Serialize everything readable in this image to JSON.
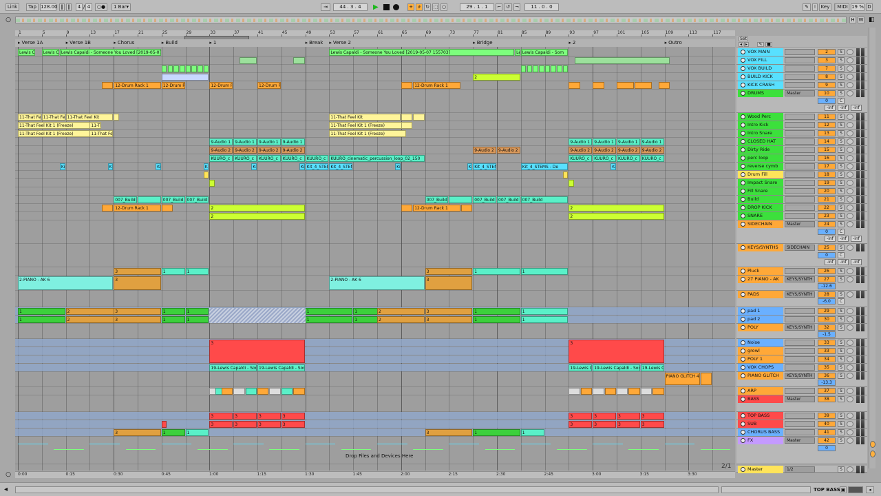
{
  "transport": {
    "link": "Link",
    "tap": "Tap",
    "tempo": "128.00",
    "signature_num": "4",
    "signature_den": "4",
    "metronome": "○●",
    "quantize": "1 Bar",
    "position": "44 .  3 .  4",
    "loop_start": "29 .  1 .  1",
    "loop_length": "11 .  0 .  0",
    "key": "Key",
    "midi": "MIDI",
    "cpu": "19 %",
    "disk": "D"
  },
  "overview_buttons": {
    "h": "H",
    "w": "W"
  },
  "ruler": {
    "bars": [
      "1",
      "5",
      "9",
      "13",
      "17",
      "21",
      "25",
      "29",
      "33",
      "37",
      "41",
      "45",
      "49",
      "53",
      "57",
      "61",
      "65",
      "69",
      "73",
      "77",
      "81",
      "85",
      "89",
      "93",
      "97",
      "101",
      "105",
      "109",
      "113",
      "117"
    ]
  },
  "locators": [
    {
      "label": "Verse 1A",
      "bar": 1
    },
    {
      "label": "Verse 1B",
      "bar": 9
    },
    {
      "label": "Chorus",
      "bar": 17
    },
    {
      "label": "Build",
      "bar": 25
    },
    {
      "label": "1",
      "bar": 33
    },
    {
      "label": "Break",
      "bar": 49
    },
    {
      "label": "Verse 2",
      "bar": 53
    },
    {
      "label": "Bridge",
      "bar": 77
    },
    {
      "label": "2",
      "bar": 93
    },
    {
      "label": "Outro",
      "bar": 109
    }
  ],
  "time_ruler": [
    "0:00",
    "0:15",
    "0:30",
    "0:45",
    "1:00",
    "1:15",
    "1:30",
    "1:45",
    "2:00",
    "2:15",
    "2:30",
    "2:45",
    "3:00",
    "3:15",
    "3:30"
  ],
  "drop_hint": "Drop Files and Devices Here",
  "page_indicator": "2/1",
  "set_label": "Set",
  "tracks": [
    {
      "name": "VOX MAIN",
      "color": "#58e0ff",
      "num": "2",
      "fold": false
    },
    {
      "name": "VOX FILL",
      "color": "#58e0ff",
      "num": "3",
      "fold": false
    },
    {
      "name": "VOX BUILD",
      "color": "#58e0ff",
      "num": "7",
      "fold": false
    },
    {
      "name": "BUILD KICK",
      "color": "#58e0ff",
      "num": "8",
      "fold": false
    },
    {
      "name": "KICK CRASH",
      "color": "#58e0ff",
      "num": "9",
      "fold": false
    },
    {
      "name": "DRUMS",
      "color": "#3ce03c",
      "num": "10",
      "route": "Master",
      "fold": true
    },
    {
      "name": "Wood Perc",
      "color": "#3ce03c",
      "num": "11",
      "fold": false
    },
    {
      "name": "Intro Kick",
      "color": "#3ce03c",
      "num": "12",
      "fold": false
    },
    {
      "name": "Intro Snare",
      "color": "#3ce03c",
      "num": "13",
      "fold": false
    },
    {
      "name": "CLOSED HAT",
      "color": "#3ce03c",
      "num": "14",
      "fold": false
    },
    {
      "name": "Dirty Ride",
      "color": "#3ce03c",
      "num": "15",
      "fold": false
    },
    {
      "name": "perc loop",
      "color": "#3ce03c",
      "num": "16",
      "fold": false
    },
    {
      "name": "reverse cymb",
      "color": "#3ce03c",
      "num": "17",
      "fold": false
    },
    {
      "name": "Drum Fill",
      "color": "#ffe45a",
      "num": "18",
      "fold": false
    },
    {
      "name": "Impact Snare",
      "color": "#3ce03c",
      "num": "19",
      "fold": false
    },
    {
      "name": "Fill Snare",
      "color": "#3ce03c",
      "num": "20",
      "fold": false
    },
    {
      "name": "Build",
      "color": "#3ce03c",
      "num": "21",
      "fold": false
    },
    {
      "name": "DROP KICK",
      "color": "#3ce03c",
      "num": "22",
      "fold": false
    },
    {
      "name": "SNARE",
      "color": "#3ce03c",
      "num": "23",
      "fold": false
    },
    {
      "name": "SIDECHAIN",
      "color": "#ffa838",
      "num": "24",
      "route": "Master",
      "fold": true
    },
    {
      "name": "KEYS/SYNTHS",
      "color": "#ffa838",
      "num": "25",
      "route": "SIDECHAIN",
      "fold": true
    },
    {
      "name": "Pluck",
      "color": "#ffa838",
      "num": "26",
      "fold": false
    },
    {
      "name": "27 PIANO - AK",
      "color": "#ffa838",
      "num": "27",
      "route": "KEYS/SYNTH",
      "fold": false
    },
    {
      "name": "PADS",
      "color": "#ffa838",
      "num": "28",
      "route": "KEYS/SYNTH",
      "fold": true
    },
    {
      "name": "pad 1",
      "color": "#6ab0ff",
      "num": "29",
      "fold": false
    },
    {
      "name": "pad 2",
      "color": "#6ab0ff",
      "num": "30",
      "fold": false
    },
    {
      "name": "POLY",
      "color": "#ffa838",
      "num": "32",
      "route": "KEYS/SYNTH",
      "fold": true
    },
    {
      "name": "Noise",
      "color": "#6ab0ff",
      "num": "33",
      "fold": false
    },
    {
      "name": "growl",
      "color": "#ffa838",
      "num": "33",
      "fold": false
    },
    {
      "name": "POLY 1",
      "color": "#ffa838",
      "num": "34",
      "fold": false
    },
    {
      "name": "VOX CHOPS",
      "color": "#6ab0ff",
      "num": "35",
      "fold": false
    },
    {
      "name": "PIANO GLITCH",
      "color": "#ffa838",
      "num": "36",
      "route": "KEYS/SYNTH",
      "fold": false
    },
    {
      "name": "ARP",
      "color": "#ffa838",
      "num": "37",
      "fold": false
    },
    {
      "name": "BASS",
      "color": "#ff4a4a",
      "num": "38",
      "route": "Master",
      "fold": true
    },
    {
      "name": "TOP BASS",
      "color": "#ff4a4a",
      "num": "39",
      "fold": false
    },
    {
      "name": "SUB",
      "color": "#ff4a4a",
      "num": "40",
      "fold": false
    },
    {
      "name": "CHORUS BASS",
      "color": "#6ab0ff",
      "num": "41",
      "fold": false
    },
    {
      "name": "FX",
      "color": "#c49aff",
      "num": "42",
      "route": "Master",
      "fold": true
    },
    {
      "name": "Master",
      "color": "#ffe45a",
      "num": "",
      "route": "1/2",
      "fold": false
    }
  ],
  "group_values": {
    "inf_a": "-inf",
    "inf_b": "-inf",
    "inf_c": "-inf",
    "zero": "0",
    "c": "C",
    "vol_piano": "-12.6",
    "vol_pads": "-6.0",
    "vol_poly": "-1.5",
    "vol_glitch": "-13.3"
  },
  "clips": {
    "vox_main_1": "Lewis C",
    "vox_main_2": "Lewis C",
    "vox_main_3": "Lewis Capaldi - Someone You Loved [2019-05-07",
    "vox_main_4": "Lewis Capaldi - Someone You Loved [2019-05-07 155703]",
    "vox_main_5": "Le",
    "vox_main_6": "Lewis Capaldi - Som",
    "drum_rack": "12-Drum Rack 1",
    "drum_r": "12-Drum R",
    "feel_kit": "11-That Feel Kit",
    "feel_kit_freeze": "11-That Feel Kit 1 (Freeze)",
    "audio_a": "9-Audio 1",
    "audio_b": "9-Audio 2",
    "kuuro": "KUURO_cinematic_percussion_loop_02_150",
    "kuuro_short": "KUURO_c",
    "kit_stems": "Kit_4_STEMS - De",
    "kit": "Kit",
    "build007": "007_Build",
    "piano_ak": "2-PIANO - AK 6",
    "vox_chops": "19-Lewis Capaldi - Som",
    "piano_glitch": "PIANO GLITCH 4",
    "num_1": "1",
    "num_2": "2",
    "num_3": "3"
  },
  "status": {
    "selected_track": "TOP BASS"
  }
}
